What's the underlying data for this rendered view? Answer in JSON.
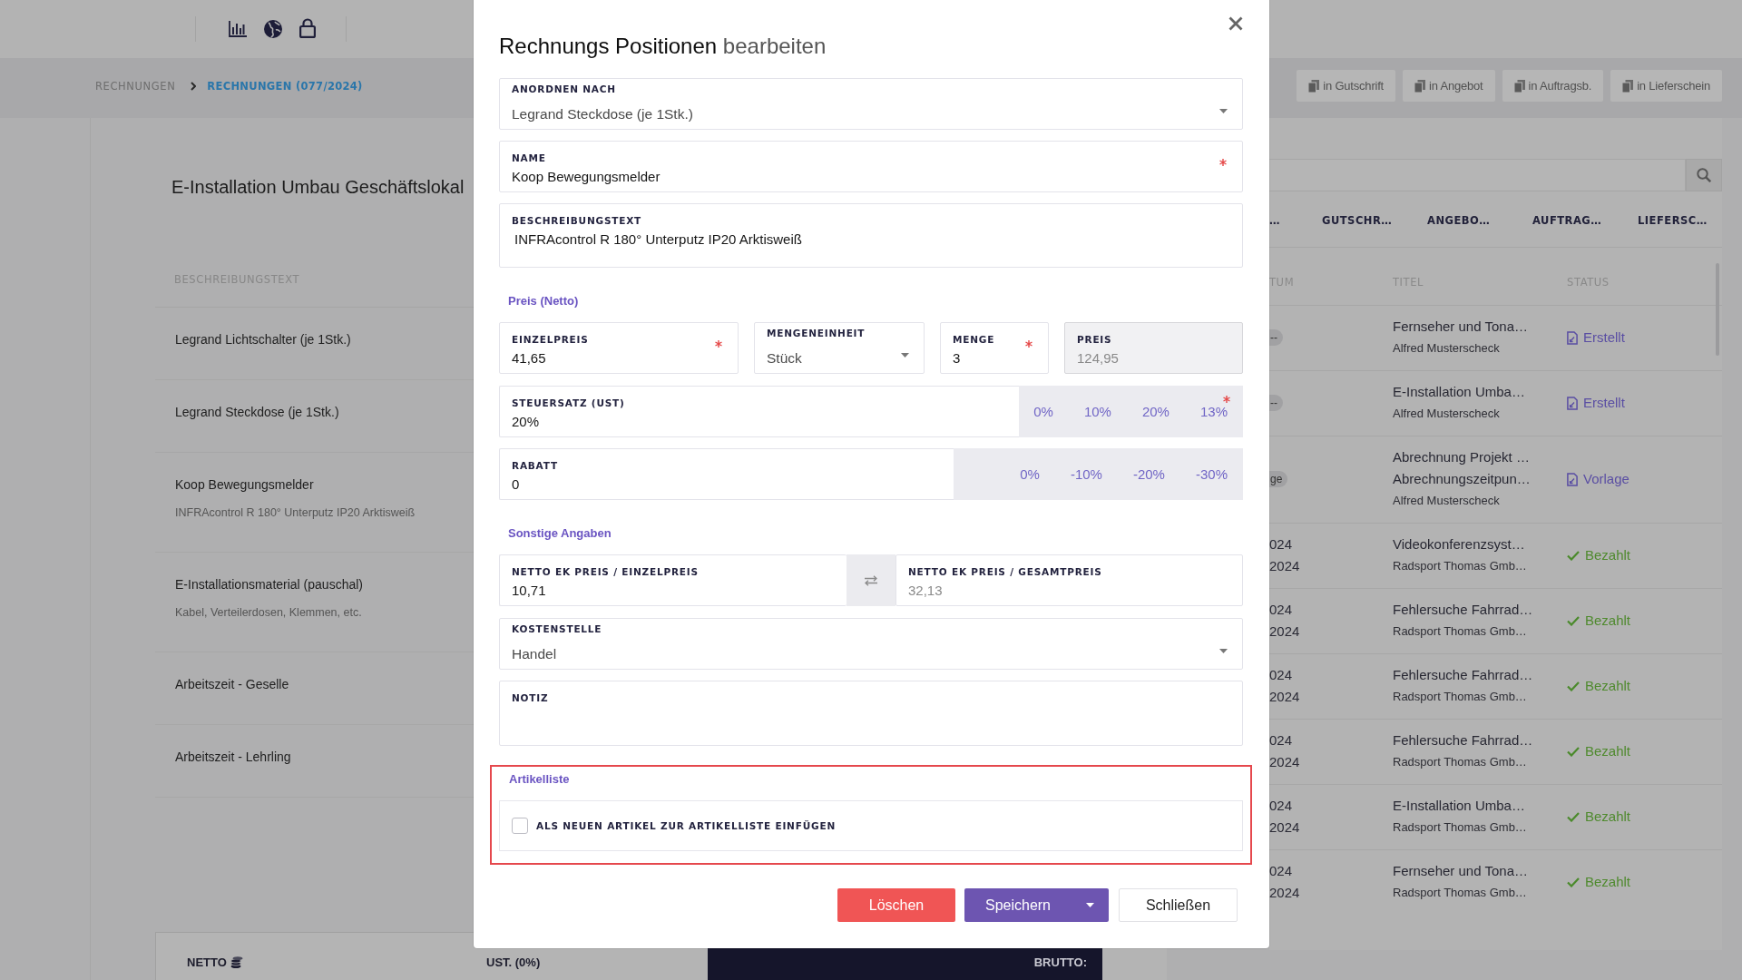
{
  "breadcrumb": [
    {
      "label": "RECHNUNGEN",
      "selected": false
    },
    {
      "label": "RECHNUNGEN (077/2024)",
      "selected": true
    }
  ],
  "convert_buttons": [
    "in Gutschrift",
    "in Angebot",
    "in Auftragsb.",
    "in Lieferschein"
  ],
  "document": {
    "title": "E-Installation Umbau Geschäftslokal",
    "columns": [
      "BESCHREIBUNGSTEXT"
    ],
    "rows": [
      {
        "name": "Legrand Lichtschalter (je 1Stk.)"
      },
      {
        "name": "Legrand Steckdose (je 1Stk.)"
      },
      {
        "name": "Koop Bewegungsmelder",
        "description": "INFRAcontrol R 180° Unterputz IP20 Arktisweiß"
      },
      {
        "name": "E-Installationsmaterial (pauschal)",
        "description": "Kabel, Verteilerdosen, Klemmen, etc."
      },
      {
        "name": "Arbeitszeit - Geselle"
      },
      {
        "name": "Arbeitszeit - Lehrling"
      }
    ]
  },
  "totals_bar": {
    "netto": "NETTO",
    "ust": "UST. (0%)",
    "brutto": "BRUTTO:"
  },
  "invoice_list": {
    "tabs": [
      "…",
      "GUTSCHR…",
      "ANGEBO…",
      "AUFTRAG…",
      "LIEFERSC…"
    ],
    "columns": [
      "TUM",
      "TITEL",
      "STATUS"
    ],
    "rows": [
      {
        "date_badge": "--",
        "title": [
          "Fernseher und Tona…"
        ],
        "customer": "Alfred Musterscheck",
        "status": {
          "label": "Erstellt",
          "kind": "document"
        }
      },
      {
        "date_badge": "--",
        "title": [
          "E-Installation Umba…"
        ],
        "customer": "Alfred Musterscheck",
        "status": {
          "label": "Erstellt",
          "kind": "document"
        }
      },
      {
        "date_badge": "ge",
        "title": [
          "Abrechnung Projekt …",
          "Abrechnungszeitpun…"
        ],
        "customer": "Alfred Musterscheck",
        "status": {
          "label": "Vorlage",
          "kind": "document"
        }
      },
      {
        "dates": [
          "024",
          "2024"
        ],
        "title": [
          "Videokonferenzsyst…"
        ],
        "customer": "Radsport Thomas Gmb…",
        "status": {
          "label": "Bezahlt",
          "kind": "paid"
        }
      },
      {
        "dates": [
          "024",
          "2024"
        ],
        "title": [
          "Fehlersuche Fahrrad…"
        ],
        "customer": "Radsport Thomas Gmb…",
        "status": {
          "label": "Bezahlt",
          "kind": "paid"
        }
      },
      {
        "dates": [
          "024",
          "2024"
        ],
        "title": [
          "Fehlersuche Fahrrad…"
        ],
        "customer": "Radsport Thomas Gmb…",
        "status": {
          "label": "Bezahlt",
          "kind": "paid"
        }
      },
      {
        "dates": [
          "024",
          "2024"
        ],
        "title": [
          "Fehlersuche Fahrrad…"
        ],
        "customer": "Radsport Thomas Gmb…",
        "status": {
          "label": "Bezahlt",
          "kind": "paid"
        }
      },
      {
        "dates": [
          "024",
          "2024"
        ],
        "title": [
          "E-Installation Umba…"
        ],
        "customer": "Radsport Thomas Gmb…",
        "status": {
          "label": "Bezahlt",
          "kind": "paid"
        }
      },
      {
        "dates": [
          "024",
          "2024"
        ],
        "title": [
          "Fernseher und Tona…"
        ],
        "customer": "Radsport Thomas Gmb…",
        "status": {
          "label": "Bezahlt",
          "kind": "paid"
        }
      }
    ]
  },
  "dialog": {
    "title": "**Rechnungs Positionen** bearbeiten",
    "sort_by": {
      "label": "ANORDNEN NACH",
      "value": "Legrand Steckdose (je 1Stk.)",
      "required": false
    },
    "name": {
      "label": "NAME",
      "value": "Koop Bewegungsmelder",
      "required": true
    },
    "description": {
      "label": "BESCHREIBUNGSTEXT",
      "value": "INFRAcontrol R 180° Unterputz IP20 Arktisweiß",
      "required": false
    },
    "price_heading": "Preis (Netto)",
    "price_fields": [
      {
        "kind": "input",
        "label": "EINZELPREIS",
        "value": "41,65",
        "required": true,
        "disabled": false
      },
      {
        "kind": "select",
        "label": "MENGENEINHEIT",
        "value": "Stück",
        "required": false,
        "disabled": false
      },
      {
        "kind": "input",
        "label": "MENGE",
        "value": "3",
        "required": true,
        "disabled": false
      },
      {
        "kind": "input",
        "label": "PREIS",
        "value": "124,95",
        "required": false,
        "disabled": true
      }
    ],
    "tax": {
      "label": "STEUERSATZ (UST)",
      "value": "20%",
      "required": true,
      "presets": [
        "0%",
        "10%",
        "20%",
        "13%"
      ]
    },
    "discount": {
      "label": "RABATT",
      "value": "0",
      "required": false,
      "presets": [
        "0%",
        "-10%",
        "-20%",
        "-30%"
      ]
    },
    "other_heading": "Sonstige Angaben",
    "purchase_price": [
      {
        "label": "NETTO EK PREIS / EINZELPREIS",
        "value": "10,71",
        "readonly": false
      },
      {
        "label": "NETTO EK PREIS / GESAMTPREIS",
        "value": "32,13",
        "readonly": true
      }
    ],
    "cost_center": {
      "label": "KOSTENSTELLE",
      "value": "Handel",
      "required": false
    },
    "note": {
      "label": "NOTIZ",
      "required": false
    },
    "article_list": {
      "heading": "Artikelliste",
      "highlighted": true,
      "option": {
        "label": "ALS NEUEN ARTIKEL ZUR ARTIKELLISTE EINFÜGEN",
        "checked": false
      }
    },
    "buttons": [
      {
        "label": "Löschen",
        "kind": "danger",
        "menu": false
      },
      {
        "label": "Speichern",
        "kind": "primary",
        "menu": true
      },
      {
        "label": "Schließen",
        "kind": "secondary",
        "menu": false
      }
    ]
  }
}
